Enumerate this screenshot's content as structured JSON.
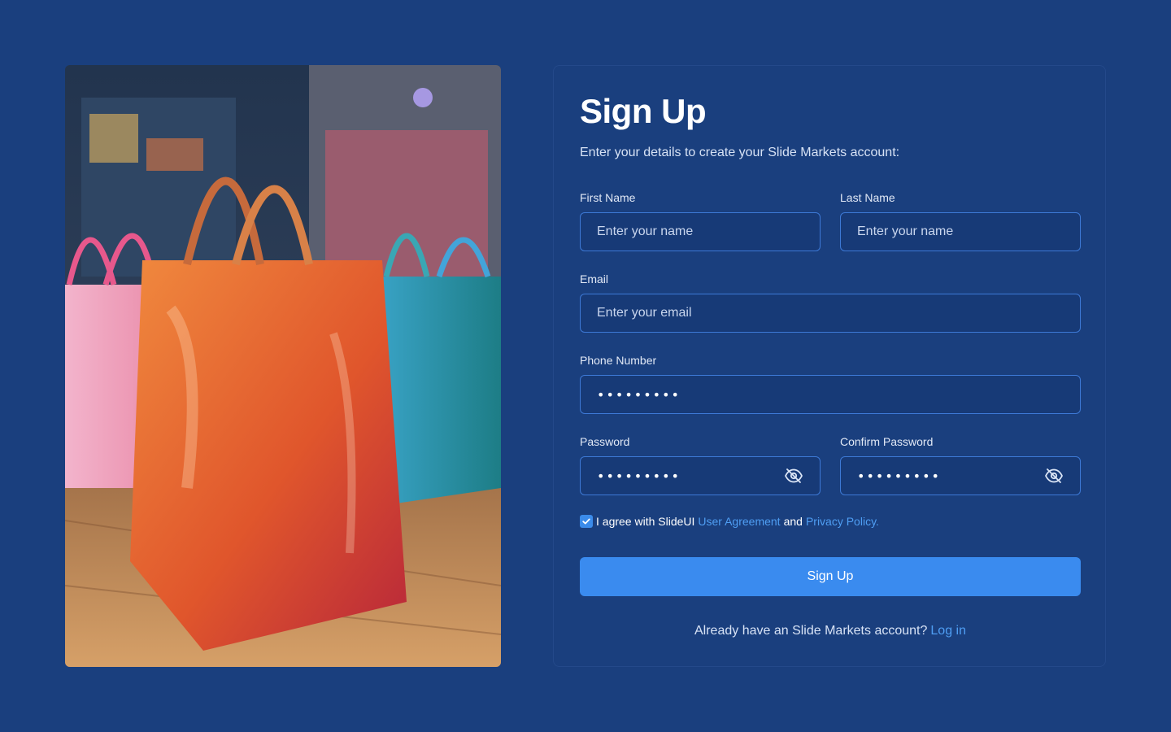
{
  "form": {
    "title": "Sign Up",
    "subtitle": "Enter your details to create your Slide Markets account:",
    "first_name": {
      "label": "First Name",
      "placeholder": "Enter your name"
    },
    "last_name": {
      "label": "Last Name",
      "placeholder": "Enter your name"
    },
    "email": {
      "label": "Email",
      "placeholder": "Enter your email"
    },
    "phone": {
      "label": "Phone Number",
      "value": "•••••••••"
    },
    "password": {
      "label": "Password",
      "value": "•••••••••",
      "icon": "eye-off-icon"
    },
    "confirm_password": {
      "label": "Confirm Password",
      "value": "•••••••••",
      "icon": "eye-off-icon"
    },
    "agreement": {
      "checked": true,
      "prefix": "I agree with SlideUI",
      "user_agreement": "User Agreement",
      "and": "and",
      "privacy_policy": "Privacy Policy."
    },
    "submit_label": "Sign Up",
    "footer": {
      "text": "Already have an Slide Markets account?",
      "login_link": "Log in"
    }
  },
  "colors": {
    "background": "#1a3f7e",
    "field_border": "#3d79d6",
    "accent": "#3a8bef",
    "link": "#4f9ef3"
  }
}
